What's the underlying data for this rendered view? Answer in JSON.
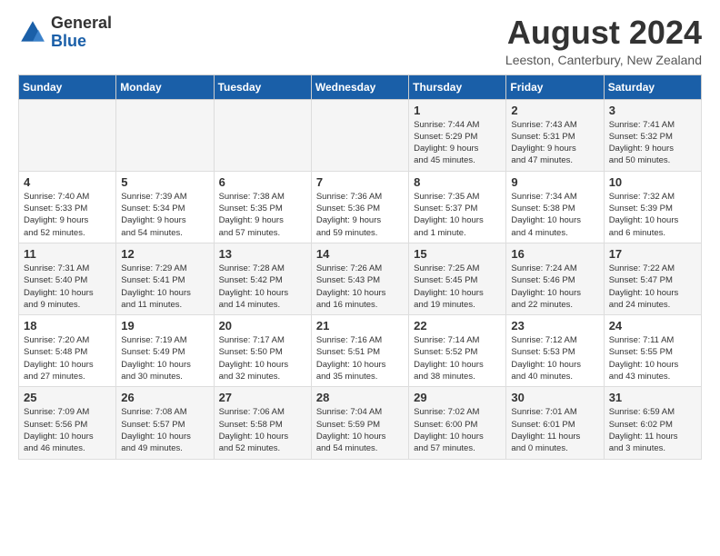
{
  "logo": {
    "general": "General",
    "blue": "Blue"
  },
  "header": {
    "title": "August 2024",
    "subtitle": "Leeston, Canterbury, New Zealand"
  },
  "days_of_week": [
    "Sunday",
    "Monday",
    "Tuesday",
    "Wednesday",
    "Thursday",
    "Friday",
    "Saturday"
  ],
  "weeks": [
    [
      {
        "day": "",
        "info": ""
      },
      {
        "day": "",
        "info": ""
      },
      {
        "day": "",
        "info": ""
      },
      {
        "day": "",
        "info": ""
      },
      {
        "day": "1",
        "info": "Sunrise: 7:44 AM\nSunset: 5:29 PM\nDaylight: 9 hours\nand 45 minutes."
      },
      {
        "day": "2",
        "info": "Sunrise: 7:43 AM\nSunset: 5:31 PM\nDaylight: 9 hours\nand 47 minutes."
      },
      {
        "day": "3",
        "info": "Sunrise: 7:41 AM\nSunset: 5:32 PM\nDaylight: 9 hours\nand 50 minutes."
      }
    ],
    [
      {
        "day": "4",
        "info": "Sunrise: 7:40 AM\nSunset: 5:33 PM\nDaylight: 9 hours\nand 52 minutes."
      },
      {
        "day": "5",
        "info": "Sunrise: 7:39 AM\nSunset: 5:34 PM\nDaylight: 9 hours\nand 54 minutes."
      },
      {
        "day": "6",
        "info": "Sunrise: 7:38 AM\nSunset: 5:35 PM\nDaylight: 9 hours\nand 57 minutes."
      },
      {
        "day": "7",
        "info": "Sunrise: 7:36 AM\nSunset: 5:36 PM\nDaylight: 9 hours\nand 59 minutes."
      },
      {
        "day": "8",
        "info": "Sunrise: 7:35 AM\nSunset: 5:37 PM\nDaylight: 10 hours\nand 1 minute."
      },
      {
        "day": "9",
        "info": "Sunrise: 7:34 AM\nSunset: 5:38 PM\nDaylight: 10 hours\nand 4 minutes."
      },
      {
        "day": "10",
        "info": "Sunrise: 7:32 AM\nSunset: 5:39 PM\nDaylight: 10 hours\nand 6 minutes."
      }
    ],
    [
      {
        "day": "11",
        "info": "Sunrise: 7:31 AM\nSunset: 5:40 PM\nDaylight: 10 hours\nand 9 minutes."
      },
      {
        "day": "12",
        "info": "Sunrise: 7:29 AM\nSunset: 5:41 PM\nDaylight: 10 hours\nand 11 minutes."
      },
      {
        "day": "13",
        "info": "Sunrise: 7:28 AM\nSunset: 5:42 PM\nDaylight: 10 hours\nand 14 minutes."
      },
      {
        "day": "14",
        "info": "Sunrise: 7:26 AM\nSunset: 5:43 PM\nDaylight: 10 hours\nand 16 minutes."
      },
      {
        "day": "15",
        "info": "Sunrise: 7:25 AM\nSunset: 5:45 PM\nDaylight: 10 hours\nand 19 minutes."
      },
      {
        "day": "16",
        "info": "Sunrise: 7:24 AM\nSunset: 5:46 PM\nDaylight: 10 hours\nand 22 minutes."
      },
      {
        "day": "17",
        "info": "Sunrise: 7:22 AM\nSunset: 5:47 PM\nDaylight: 10 hours\nand 24 minutes."
      }
    ],
    [
      {
        "day": "18",
        "info": "Sunrise: 7:20 AM\nSunset: 5:48 PM\nDaylight: 10 hours\nand 27 minutes."
      },
      {
        "day": "19",
        "info": "Sunrise: 7:19 AM\nSunset: 5:49 PM\nDaylight: 10 hours\nand 30 minutes."
      },
      {
        "day": "20",
        "info": "Sunrise: 7:17 AM\nSunset: 5:50 PM\nDaylight: 10 hours\nand 32 minutes."
      },
      {
        "day": "21",
        "info": "Sunrise: 7:16 AM\nSunset: 5:51 PM\nDaylight: 10 hours\nand 35 minutes."
      },
      {
        "day": "22",
        "info": "Sunrise: 7:14 AM\nSunset: 5:52 PM\nDaylight: 10 hours\nand 38 minutes."
      },
      {
        "day": "23",
        "info": "Sunrise: 7:12 AM\nSunset: 5:53 PM\nDaylight: 10 hours\nand 40 minutes."
      },
      {
        "day": "24",
        "info": "Sunrise: 7:11 AM\nSunset: 5:55 PM\nDaylight: 10 hours\nand 43 minutes."
      }
    ],
    [
      {
        "day": "25",
        "info": "Sunrise: 7:09 AM\nSunset: 5:56 PM\nDaylight: 10 hours\nand 46 minutes."
      },
      {
        "day": "26",
        "info": "Sunrise: 7:08 AM\nSunset: 5:57 PM\nDaylight: 10 hours\nand 49 minutes."
      },
      {
        "day": "27",
        "info": "Sunrise: 7:06 AM\nSunset: 5:58 PM\nDaylight: 10 hours\nand 52 minutes."
      },
      {
        "day": "28",
        "info": "Sunrise: 7:04 AM\nSunset: 5:59 PM\nDaylight: 10 hours\nand 54 minutes."
      },
      {
        "day": "29",
        "info": "Sunrise: 7:02 AM\nSunset: 6:00 PM\nDaylight: 10 hours\nand 57 minutes."
      },
      {
        "day": "30",
        "info": "Sunrise: 7:01 AM\nSunset: 6:01 PM\nDaylight: 11 hours\nand 0 minutes."
      },
      {
        "day": "31",
        "info": "Sunrise: 6:59 AM\nSunset: 6:02 PM\nDaylight: 11 hours\nand 3 minutes."
      }
    ]
  ]
}
